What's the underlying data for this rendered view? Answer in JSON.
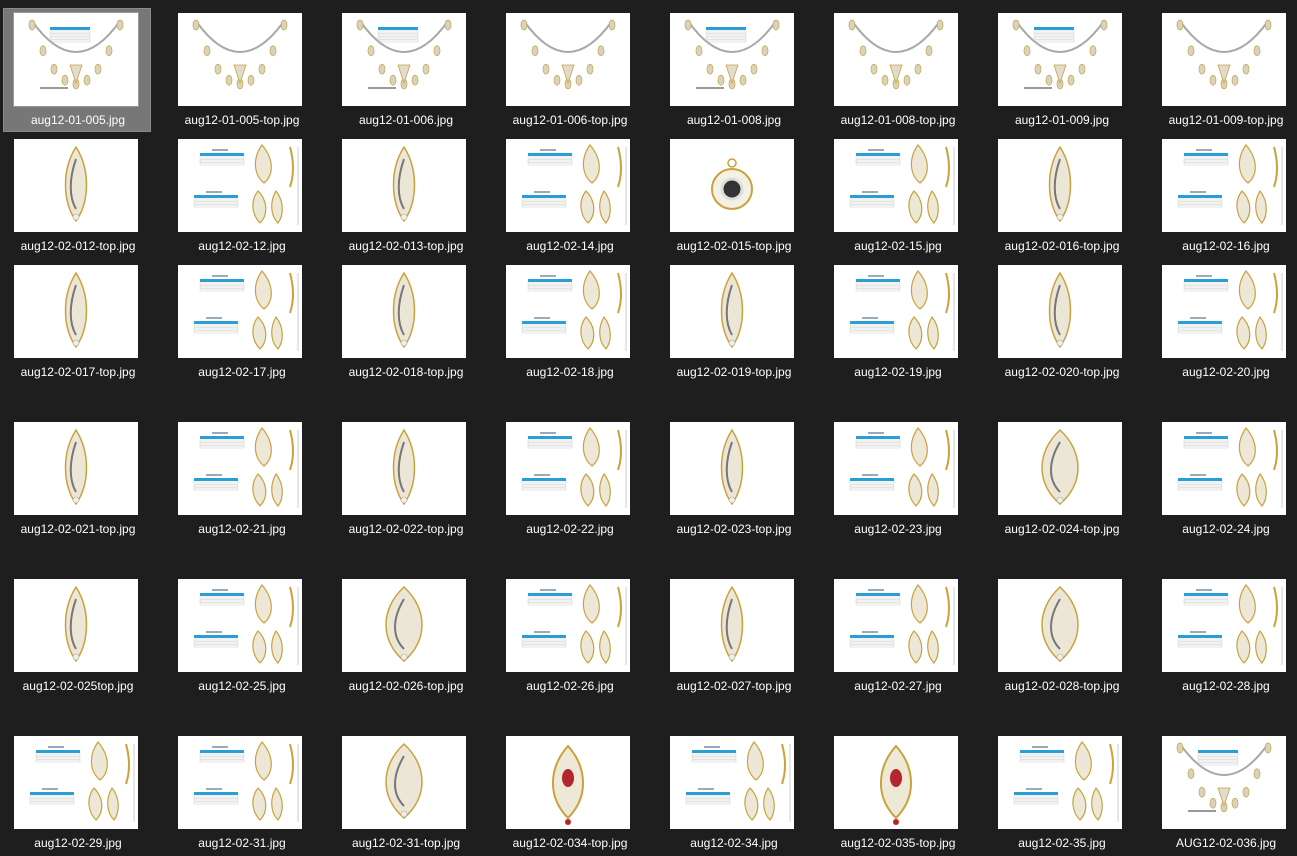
{
  "colors": {
    "background": "#1e1e1e",
    "selected_bg": "#777777",
    "label": "#ffffff",
    "thumb_bg": "#ffffff",
    "metal_gold": "#c9a23a",
    "metal_silver": "#a9a9a9",
    "table_header": "#2a9fd6"
  },
  "files": [
    {
      "name": "aug12-01-005.jpg",
      "kind": "necklace-spec",
      "selected": true
    },
    {
      "name": "aug12-01-005-top.jpg",
      "kind": "necklace"
    },
    {
      "name": "aug12-01-006.jpg",
      "kind": "necklace-spec"
    },
    {
      "name": "aug12-01-006-top.jpg",
      "kind": "necklace"
    },
    {
      "name": "aug12-01-008.jpg",
      "kind": "necklace-spec"
    },
    {
      "name": "aug12-01-008-top.jpg",
      "kind": "necklace"
    },
    {
      "name": "aug12-01-009.jpg",
      "kind": "necklace-spec"
    },
    {
      "name": "aug12-01-009-top.jpg",
      "kind": "necklace"
    },
    {
      "name": "aug12-02-012-top.jpg",
      "kind": "pendant"
    },
    {
      "name": "aug12-02-12.jpg",
      "kind": "set-spec"
    },
    {
      "name": "aug12-02-013-top.jpg",
      "kind": "pendant"
    },
    {
      "name": "aug12-02-14.jpg",
      "kind": "set-spec"
    },
    {
      "name": "aug12-02-015-top.jpg",
      "kind": "pendant-round"
    },
    {
      "name": "aug12-02-15.jpg",
      "kind": "set-spec"
    },
    {
      "name": "aug12-02-016-top.jpg",
      "kind": "pendant"
    },
    {
      "name": "aug12-02-16.jpg",
      "kind": "set-spec"
    },
    {
      "name": "aug12-02-017-top.jpg",
      "kind": "pendant"
    },
    {
      "name": "aug12-02-17.jpg",
      "kind": "set-spec"
    },
    {
      "name": "aug12-02-018-top.jpg",
      "kind": "pendant"
    },
    {
      "name": "aug12-02-18.jpg",
      "kind": "set-spec"
    },
    {
      "name": "aug12-02-019-top.jpg",
      "kind": "pendant"
    },
    {
      "name": "aug12-02-19.jpg",
      "kind": "set-spec"
    },
    {
      "name": "aug12-02-020-top.jpg",
      "kind": "pendant"
    },
    {
      "name": "aug12-02-20.jpg",
      "kind": "set-spec"
    },
    {
      "name": "aug12-02-021-top.jpg",
      "kind": "pendant"
    },
    {
      "name": "aug12-02-21.jpg",
      "kind": "set-spec"
    },
    {
      "name": "aug12-02-022-top.jpg",
      "kind": "pendant"
    },
    {
      "name": "aug12-02-22.jpg",
      "kind": "set-spec"
    },
    {
      "name": "aug12-02-023-top.jpg",
      "kind": "pendant"
    },
    {
      "name": "aug12-02-23.jpg",
      "kind": "set-spec"
    },
    {
      "name": "aug12-02-024-top.jpg",
      "kind": "pendant-large"
    },
    {
      "name": "aug12-02-24.jpg",
      "kind": "set-spec"
    },
    {
      "name": "aug12-02-025top.jpg",
      "kind": "pendant"
    },
    {
      "name": "aug12-02-25.jpg",
      "kind": "set-spec"
    },
    {
      "name": "aug12-02-026-top.jpg",
      "kind": "pendant-large"
    },
    {
      "name": "aug12-02-26.jpg",
      "kind": "set-spec"
    },
    {
      "name": "aug12-02-027-top.jpg",
      "kind": "pendant"
    },
    {
      "name": "aug12-02-27.jpg",
      "kind": "set-spec"
    },
    {
      "name": "aug12-02-028-top.jpg",
      "kind": "pendant-large"
    },
    {
      "name": "aug12-02-28.jpg",
      "kind": "set-spec"
    },
    {
      "name": "aug12-02-29.jpg",
      "kind": "set-spec"
    },
    {
      "name": "aug12-02-31.jpg",
      "kind": "set-spec"
    },
    {
      "name": "aug12-02-31-top.jpg",
      "kind": "pendant-large"
    },
    {
      "name": "aug12-02-034-top.jpg",
      "kind": "pendant-ruby"
    },
    {
      "name": "aug12-02-34.jpg",
      "kind": "set-spec"
    },
    {
      "name": "aug12-02-035-top.jpg",
      "kind": "pendant-ruby"
    },
    {
      "name": "aug12-02-35.jpg",
      "kind": "set-spec"
    },
    {
      "name": "AUG12-02-036.jpg",
      "kind": "necklace-spec"
    }
  ]
}
